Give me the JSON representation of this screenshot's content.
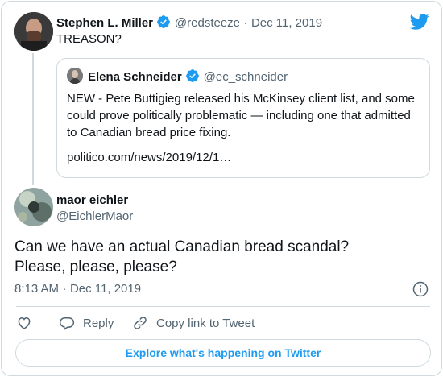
{
  "retweeted_tweet": {
    "author_name": "Stephen L. Miller",
    "handle": "@redsteeze",
    "separator": "·",
    "date": "Dec 11, 2019",
    "text": "TREASON?"
  },
  "quoted_tweet": {
    "author_name": "Elena Schneider",
    "handle": "@ec_schneider",
    "text": "NEW - Pete Buttigieg released his McKinsey client list, and some could prove politically problematic — including one that admitted to Canadian bread price fixing.",
    "link": "politico.com/news/2019/12/1…"
  },
  "main_tweet": {
    "author_name": "maor eichler",
    "handle": "@EichlerMaor",
    "text_line1": "Can we have an actual Canadian bread scandal?",
    "text_line2": "Please, please, please?",
    "time": "8:13 AM",
    "separator": "·",
    "date": "Dec 11, 2019"
  },
  "actions": {
    "reply_label": "Reply",
    "copy_link_label": "Copy link to Tweet"
  },
  "explore_label": "Explore what's happening on Twitter",
  "colors": {
    "twitter_blue": "#1d9bf0",
    "text": "#0f1419",
    "muted": "#536471",
    "border": "#cfd9de"
  },
  "icons": [
    "twitter-bird-icon",
    "verified-badge-icon",
    "info-icon",
    "heart-icon",
    "reply-icon",
    "link-icon"
  ]
}
